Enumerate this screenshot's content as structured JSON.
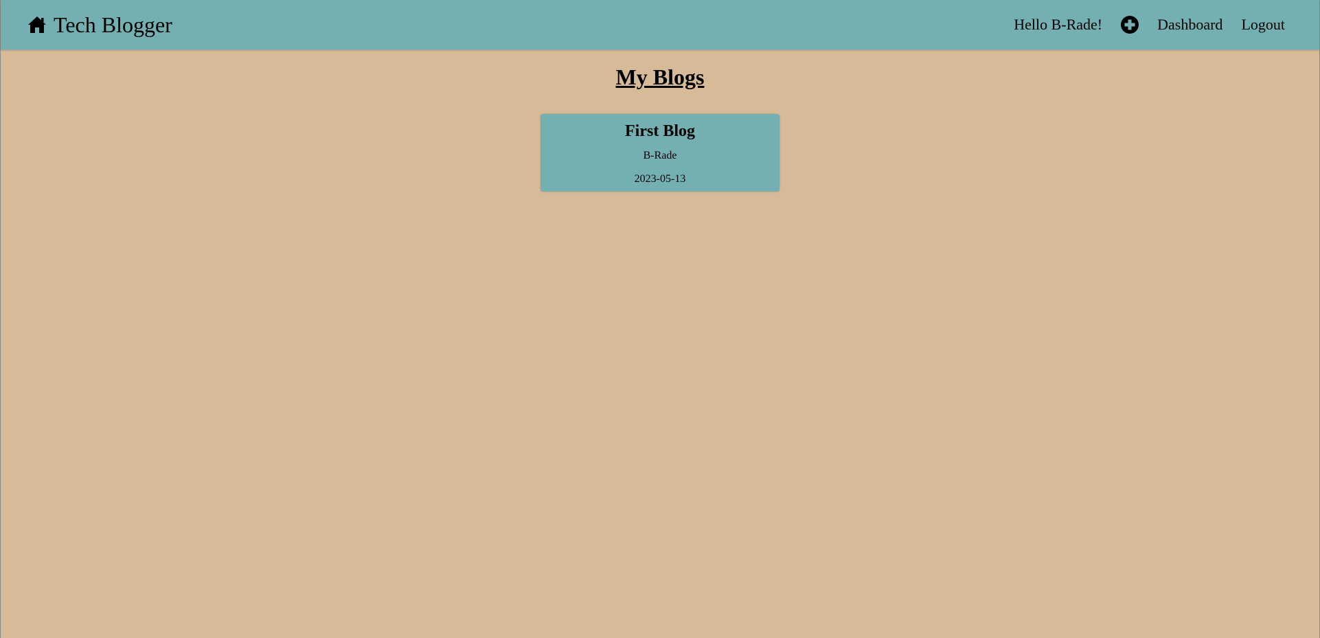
{
  "navbar": {
    "brand_title": "Tech Blogger",
    "brand_icon": "home-icon",
    "greeting": "Hello B-Rade!",
    "add_icon": "plus-circle-icon",
    "links": [
      {
        "label": "Dashboard"
      },
      {
        "label": "Logout"
      }
    ]
  },
  "main": {
    "title": "My Blogs",
    "blogs": [
      {
        "title": "First Blog",
        "author": "B-Rade",
        "date": "2023-05-13"
      }
    ]
  },
  "colors": {
    "navbar_bg": "#74b0b2",
    "page_bg": "#d7bb98",
    "card_bg": "#74b0b2"
  }
}
